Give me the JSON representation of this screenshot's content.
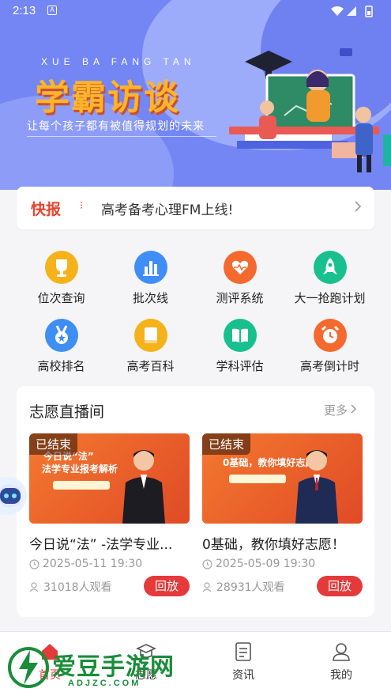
{
  "status_bar": {
    "time": "2:13",
    "app_indicator": "A"
  },
  "banner": {
    "pinyin": "XUE BA FANG TAN",
    "title": "学霸访谈",
    "slogan": "让每个孩子都有被值得规划的未来"
  },
  "news": {
    "tag": "快报",
    "text": "高考备考心理FM上线!"
  },
  "features": [
    {
      "label": "位次查询",
      "icon": "trophy-icon",
      "color": "#f5b21a"
    },
    {
      "label": "批次线",
      "icon": "bar-chart-icon",
      "color": "#3f8ef5"
    },
    {
      "label": "测评系统",
      "icon": "heart-icon",
      "color": "#f46a2e"
    },
    {
      "label": "大一抢跑计划",
      "icon": "rocket-icon",
      "color": "#18c08f"
    },
    {
      "label": "高校排名",
      "icon": "medal-icon",
      "color": "#3f8ef5"
    },
    {
      "label": "高考百科",
      "icon": "book-icon",
      "color": "#f5b21a"
    },
    {
      "label": "学科评估",
      "icon": "open-book-icon",
      "color": "#18c08f"
    },
    {
      "label": "高考倒计时",
      "icon": "alarm-clock-icon",
      "color": "#f46a2e"
    }
  ],
  "live": {
    "heading": "志愿直播间",
    "more": "更多",
    "cards": [
      {
        "status": "已结束",
        "thumb_line1": "今日说“法”",
        "thumb_line2": "法学专业报考解析",
        "title": "今日说“法” -法学专业...",
        "date": "2025-05-11 19:30",
        "viewers": "31018人观看",
        "action": "回放"
      },
      {
        "status": "已结束",
        "thumb_line1": "0基础，教你填好志愿",
        "thumb_line2": "",
        "title": "0基础，教你填好志愿！",
        "date": "2025-05-09 19:30",
        "viewers": "28931人观看",
        "action": "回放"
      }
    ]
  },
  "nav": {
    "items": [
      {
        "label": "首页",
        "icon": "home-icon"
      },
      {
        "label": "志愿",
        "icon": "graduation-cap-icon"
      },
      {
        "label": "资讯",
        "icon": "document-icon"
      },
      {
        "label": "我的",
        "icon": "user-icon"
      }
    ]
  },
  "watermark": {
    "text": "爱豆手游网",
    "url": "ADJZC.COM"
  },
  "colors": {
    "accent": "#e43a3a",
    "banner": "#7486f4",
    "title_orange": "#ffb42b"
  }
}
